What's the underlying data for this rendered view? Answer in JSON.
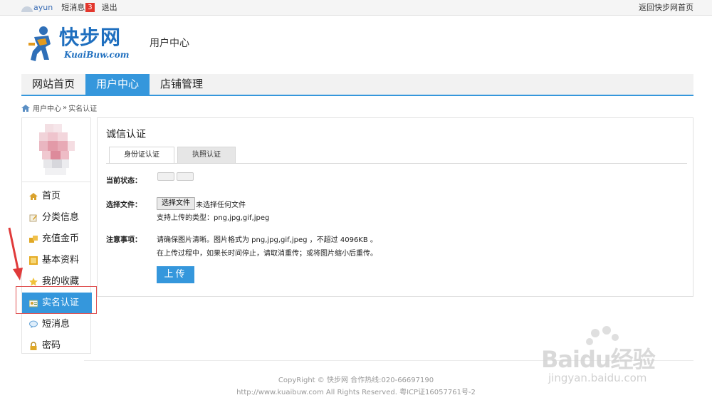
{
  "topbar": {
    "username": "ayun",
    "messages_label": "短消息",
    "messages_count": "3",
    "logout": "退出",
    "back_home": "返回快步网首页"
  },
  "header": {
    "logo_cn": "快步网",
    "logo_en": "KuaiBuw.com",
    "section_title": "用户中心"
  },
  "nav": {
    "items": [
      {
        "label": "网站首页",
        "active": false
      },
      {
        "label": "用户中心",
        "active": true
      },
      {
        "label": "店铺管理",
        "active": false
      }
    ]
  },
  "breadcrumb": {
    "parent": "用户中心",
    "sep": "»",
    "current": "实名认证"
  },
  "sidebar": {
    "items": [
      {
        "label": "首页",
        "icon": "home-icon"
      },
      {
        "label": "分类信息",
        "icon": "edit-icon"
      },
      {
        "label": "充值金币",
        "icon": "coins-icon"
      },
      {
        "label": "基本资料",
        "icon": "profile-icon"
      },
      {
        "label": "我的收藏",
        "icon": "star-icon"
      },
      {
        "label": "实名认证",
        "icon": "id-card-icon",
        "active": true
      },
      {
        "label": "短消息",
        "icon": "chat-icon"
      },
      {
        "label": "密码",
        "icon": "lock-icon"
      }
    ]
  },
  "main": {
    "title": "诚信认证",
    "tabs": [
      {
        "label": "身份证认证",
        "active": true
      },
      {
        "label": "执照认证",
        "active": false
      }
    ],
    "status_label": "当前状态：",
    "file_label": "选择文件：",
    "choose_button": "选择文件",
    "no_file": "未选择任何文件",
    "supported_types": "支持上传的类型：png,jpg,gif,jpeg",
    "notes_label": "注意事项：",
    "note1": "请确保图片清晰。图片格式为 png,jpg,gif,jpeg ，不超过 4096KB 。",
    "note2": "在上传过程中，如果长时间停止，请取消重传；或将图片缩小后重传。",
    "upload_button": "上传"
  },
  "footer": {
    "line1": "CopyRight © 快步网 合作热线:020-66697190",
    "line2": "http://www.kuaibuw.com All Rights Reserved. 粤ICP证16057761号-2"
  },
  "watermark": {
    "brand": "Baidu经验",
    "url": "jingyan.baidu.com"
  },
  "colors": {
    "accent": "#3597dc",
    "badge": "#e3372d",
    "highlight_box": "#e05353"
  }
}
